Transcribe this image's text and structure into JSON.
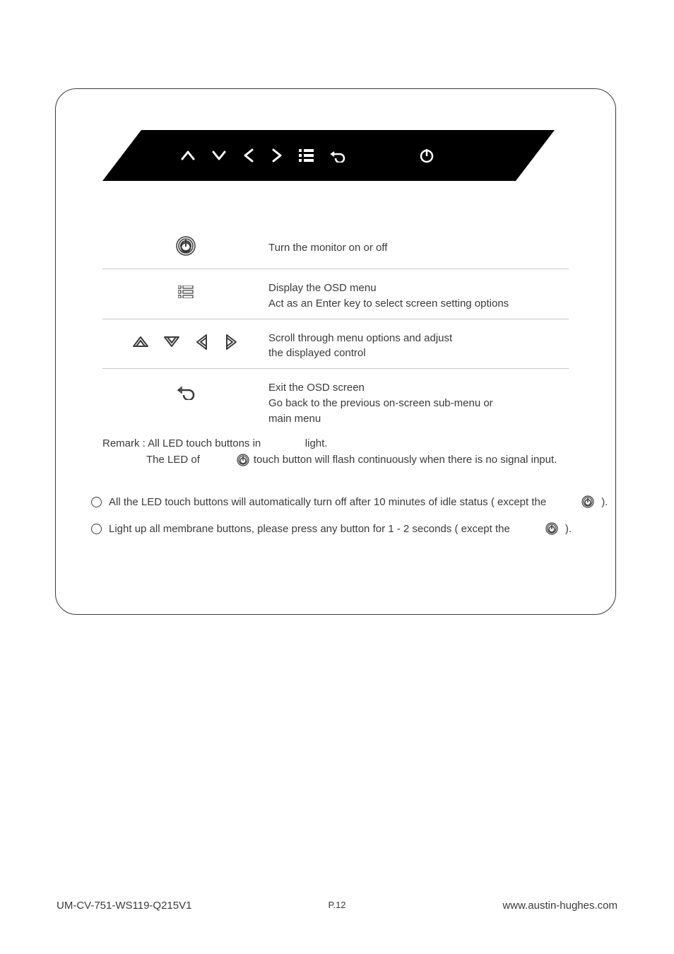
{
  "rows": [
    {
      "desc": "Turn the monitor on or off"
    },
    {
      "desc": "Display the OSD menu\nAct as an Enter key to select screen setting options"
    },
    {
      "desc": "Scroll through menu options and adjust\nthe displayed control"
    },
    {
      "desc": "Exit the OSD screen\nGo back to the previous on-screen sub-menu or\nmain menu"
    }
  ],
  "remark": {
    "line1_a": "Remark : All LED touch buttons in",
    "line1_b": "light.",
    "line2_a": "The LED of",
    "line2_b": "touch button will flash continuously when there is no signal input."
  },
  "bullets": [
    {
      "text": "All the LED touch buttons will automatically turn off after 10 minutes of idle status ( except the",
      "tail": " )."
    },
    {
      "text": "Light up all membrane buttons, please press any button for 1 - 2 seconds ( except the",
      "tail": " )."
    }
  ],
  "footer": {
    "left": "UM-CV-751-WS119-Q215V1",
    "mid": "P.12",
    "right": "www.austin-hughes.com"
  }
}
